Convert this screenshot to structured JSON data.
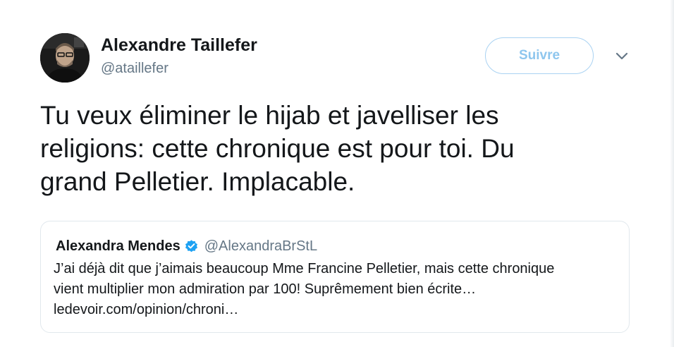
{
  "tweet": {
    "author": {
      "display_name": "Alexandre Taillefer",
      "handle": "@ataillefer"
    },
    "follow_label": "Suivre",
    "menu_icon": "chevron-down-icon",
    "text": "Tu veux éliminer le hijab et javelliser les\nreligions: cette chronique est pour toi.  Du\ngrand Pelletier.  Implacable.",
    "quoted": {
      "display_name": "Alexandra Mendes",
      "verified": true,
      "handle": "@AlexandraBrStL",
      "text_lines": [
        "J’ai déjà dit que j’aimais beaucoup Mme Francine Pelletier, mais cette chronique",
        "vient multiplier mon admiration par 100! Suprêmement bien écrite…",
        "ledevoir.com/opinion/chroni…"
      ]
    }
  },
  "colors": {
    "text": "#14171a",
    "secondary": "#657786",
    "accent": "#1da1f2",
    "follow_border": "#a9d2f2",
    "card_border": "#e1e8ed"
  }
}
